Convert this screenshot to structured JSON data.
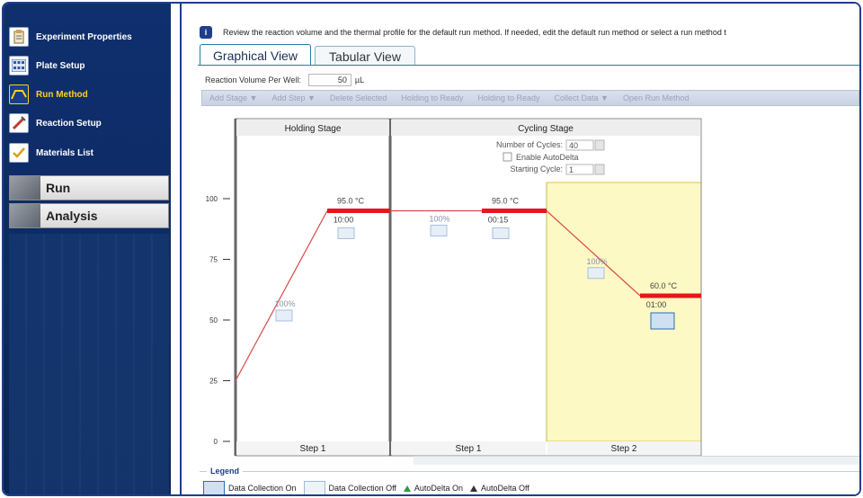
{
  "sidebar": {
    "items": [
      {
        "label": "Experiment Properties",
        "icon": "clipboard-icon"
      },
      {
        "label": "Plate Setup",
        "icon": "plate-grid-icon"
      },
      {
        "label": "Run Method",
        "icon": "thermal-curve-icon",
        "active": true
      },
      {
        "label": "Reaction Setup",
        "icon": "pipette-icon"
      },
      {
        "label": "Materials List",
        "icon": "checklist-icon"
      }
    ],
    "sections": [
      {
        "label": "Run",
        "icon": "run-icon"
      },
      {
        "label": "Analysis",
        "icon": "analysis-icon"
      }
    ]
  },
  "info": {
    "icon": "info-icon",
    "text": "Review the reaction volume and the thermal profile for the default run method. If needed, edit the default run method or select a run method t"
  },
  "tabs": [
    {
      "label": "Graphical View",
      "active": true
    },
    {
      "label": "Tabular View",
      "active": false
    }
  ],
  "volume": {
    "label": "Reaction Volume Per Well:",
    "value": "50",
    "unit": "µL"
  },
  "toolbar": {
    "items": [
      "Add Stage ▼",
      "Add Step ▼",
      "Delete Selected",
      "Holding to Ready",
      "Holding to Ready",
      "Collect Data ▼",
      "Open Run Method"
    ]
  },
  "stages": {
    "holding": {
      "title": "Holding Stage",
      "step": "Step 1"
    },
    "cycling": {
      "title": "Cycling Stage",
      "cycles_label": "Number of Cycles:",
      "cycles_value": "40",
      "autodelta_label": "Enable AutoDelta",
      "starting_label": "Starting Cycle:",
      "starting_value": "1",
      "steps": [
        "Step 1",
        "Step 2"
      ]
    }
  },
  "profile": {
    "y_ticks": [
      "100",
      "75",
      "50",
      "25",
      "0"
    ],
    "temps": [
      {
        "temp": 95.0,
        "label": "95.0 °C",
        "time": "10:00",
        "ramp": "100%"
      },
      {
        "temp": 95.0,
        "label": "95.0 °C",
        "time": "00:15",
        "ramp": "100%"
      },
      {
        "temp": 60.0,
        "label": "60.0 °C",
        "time": "01:00",
        "ramp": "100%"
      }
    ],
    "start_temp": 25,
    "colors": {
      "hold_line": "#e8151b",
      "ramp_line": "#d94a4a",
      "selected_bg": "#fdf9c4",
      "stage_border": "#8a8a8a"
    }
  },
  "legend": {
    "title": "Legend",
    "items": [
      {
        "label": "Data Collection On"
      },
      {
        "label": "Data Collection Off"
      },
      {
        "label": "AutoDelta On"
      },
      {
        "label": "AutoDelta Off"
      }
    ]
  }
}
